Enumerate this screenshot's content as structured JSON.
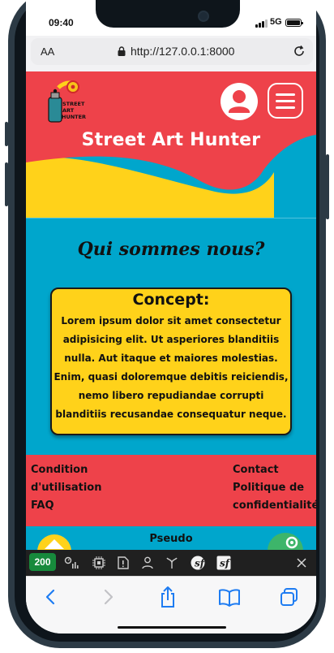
{
  "status_bar": {
    "time": "09:40",
    "network": "5G"
  },
  "browser": {
    "text_size_label": "AA",
    "url": "http://127.0.0.1:8000"
  },
  "site": {
    "logo_text": "STREET ART HUNTER",
    "title": "Street Art Hunter",
    "section_title": "Qui sommes nous?",
    "card": {
      "title": "Concept:",
      "body": "Lorem ipsum dolor sit amet consectetur adipisicing elit. Ut asperiores blanditiis nulla. Aut itaque et maiores molestias. Enim, quasi doloremque debitis reiciendis, nemo libero repudiandae corrupti blanditiis recusandae consequatur neque."
    },
    "footer": {
      "left_links": [
        "Condition",
        "d'utilisation",
        "FAQ"
      ],
      "right_links": [
        "Contact",
        "Politique de",
        "confidentialité"
      ]
    },
    "bottom_label": "Pseudo"
  },
  "debug_toolbar": {
    "status_code": "200"
  },
  "colors": {
    "brand_red": "#ee424a",
    "brand_blue": "#00a6cc",
    "brand_yellow": "#ffd21a",
    "ios_blue": "#1e7cf2",
    "debug_green": "#178a3c"
  },
  "icons": {
    "browser": [
      "lock-icon",
      "reload-icon"
    ],
    "header": [
      "user-icon",
      "hamburger-menu-icon"
    ],
    "debug": [
      "performance-icon",
      "memory-icon",
      "request-icon",
      "user-icon",
      "routing-icon",
      "symfony-icon",
      "symfony-icon",
      "close-icon"
    ],
    "toolbar": [
      "back-icon",
      "forward-icon",
      "share-icon",
      "bookmarks-icon",
      "tabs-icon"
    ]
  }
}
